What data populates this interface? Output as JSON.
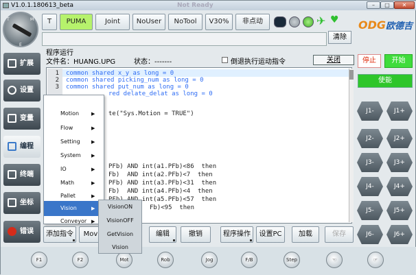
{
  "window": {
    "title": "V1.0.1.180613_beta",
    "caption": "Not Ready",
    "min": "–",
    "max": "□",
    "close": "✕"
  },
  "knob": {
    "labels": [
      "T",
      "M",
      "E"
    ]
  },
  "topbar": {
    "mode": "T",
    "robot": "PUMA",
    "coord": "Joint",
    "user": "NoUser",
    "tool": "NoTool",
    "speed": "V30%",
    "motion": "非点动",
    "status_colors": {
      "play": "#1a2a3a",
      "dot1": "#9aa2a8",
      "dot2": "#6fd14a",
      "person": "#2fbf2f",
      "heart": "#2fbf2f"
    },
    "clear": "清除"
  },
  "logo": {
    "brand": "ODG",
    "suffix": "欧德吉"
  },
  "sidebar": {
    "items": [
      {
        "label": "扩展"
      },
      {
        "label": "设置"
      },
      {
        "label": "变量"
      },
      {
        "label": "编程"
      },
      {
        "label": "终端"
      },
      {
        "label": "坐标"
      },
      {
        "label": "错误"
      }
    ]
  },
  "program": {
    "title": "程序运行",
    "file": "文件名：HUANG.UPG",
    "status": "状态：-------",
    "reverse": "倒退执行运动指令",
    "close": "关闭"
  },
  "code_lines": [
    {
      "n": "1",
      "text": "common shared x_y as long = 0"
    },
    {
      "n": "2",
      "text": "common shared picking_num as long = 0"
    },
    {
      "n": "3",
      "text": "common shared put_num as long = 0"
    },
    {
      "n": "",
      "text": "red delate_delat as long = 0"
    },
    {
      "n": "",
      "text": "te(\"Sys.Motion = TRUE\")"
    },
    {
      "n": "",
      "text": "PFb) AND int(a1.PFb)<86  then"
    },
    {
      "n": "",
      "text": "Fb)  AND int(a2.PFb)<7  then"
    },
    {
      "n": "",
      "text": "PFb) AND int(a3.PFb)<31  then"
    },
    {
      "n": "",
      "text": "Fb)  AND int(a4.PFb)<4  then"
    },
    {
      "n": "",
      "text": "PFb) AND int(a5.PFb)<57  then"
    },
    {
      "n": "",
      "text": "Fb)<95  then"
    }
  ],
  "bottom": {
    "add_instr": "添加指令",
    "mov": "Mov",
    "edit": "编辑",
    "undo": "撤销",
    "prog_op": "程序操作",
    "set_pc": "设置PC",
    "load": "加载",
    "save": "保存"
  },
  "right_panel": {
    "stop": "停止",
    "start": "开始",
    "enable": "使能",
    "jog": [
      [
        "J1-",
        "J1+"
      ],
      [
        "J2-",
        "J2+"
      ],
      [
        "J3-",
        "J3+"
      ],
      [
        "J4-",
        "J4+"
      ],
      [
        "J5-",
        "J5+"
      ],
      [
        "J6-",
        "J6+"
      ]
    ]
  },
  "fkeys": [
    "F1",
    "F2",
    "Mot",
    "Rob",
    "Jog",
    "F/B",
    "Step",
    "",
    ""
  ],
  "menu": {
    "items": [
      "Motion",
      "Flow",
      "Setting",
      "System",
      "IO",
      "Math",
      "Pallet",
      "Vision",
      "Conveyor"
    ],
    "selected": "Vision"
  },
  "submenu": {
    "items": [
      "VisionON",
      "VisionOFF",
      "GetVision",
      "Vision"
    ]
  }
}
